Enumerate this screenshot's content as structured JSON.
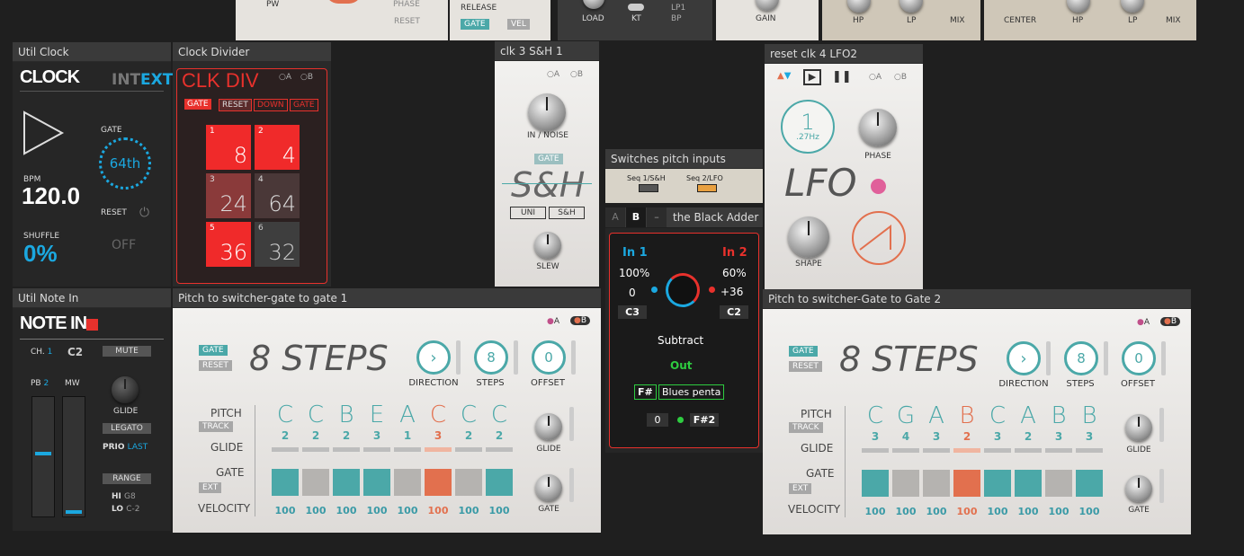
{
  "top": {
    "pw": "PW",
    "phase": "PHASE",
    "reset": "RESET",
    "release": "RELEASE",
    "gate": "GATE",
    "vel": "VEL",
    "load": "LOAD",
    "kt": "KT",
    "lp1": "LP1",
    "bp": "BP",
    "gain": "GAIN",
    "hp1": "HP",
    "lp2": "LP",
    "mix1": "MIX",
    "center": "CENTER",
    "hp2": "HP",
    "lp3": "LP",
    "mix2": "MIX"
  },
  "clock": {
    "title": "Util Clock",
    "name": "CLOCK",
    "int": "INT",
    "ext": "EXT",
    "gate": "GATE",
    "gate_val": "64th",
    "bpm_label": "BPM",
    "bpm": "120.0",
    "reset": "RESET",
    "shuffle_label": "SHUFFLE",
    "shuffle": "0%",
    "off": "OFF"
  },
  "clkdiv": {
    "title": "Clock Divider",
    "name": "CLK DIV",
    "a": "A",
    "b": "B",
    "btns": [
      "GATE",
      "RESET",
      "DOWN",
      "GATE"
    ],
    "cells": [
      {
        "n": "1",
        "v": "8"
      },
      {
        "n": "2",
        "v": "4"
      },
      {
        "n": "3",
        "v": "24"
      },
      {
        "n": "4",
        "v": "64"
      },
      {
        "n": "5",
        "v": "36"
      },
      {
        "n": "6",
        "v": "32"
      }
    ]
  },
  "sh": {
    "title": "clk 3 S&H 1",
    "a": "A",
    "b": "B",
    "in": "IN / NOISE",
    "gate": "GATE",
    "name": "S&H",
    "uni": "UNI",
    "sh": "S&H",
    "slew": "SLEW"
  },
  "sw": {
    "title": "Switches pitch inputs",
    "seq1": "Seq 1/S&H",
    "seq2": "Seq 2/LFO"
  },
  "adder": {
    "tabA": "A",
    "tabB": "B",
    "tabDash": "–",
    "title": "the Black Adder",
    "in1": "In 1",
    "in2": "In 2",
    "p1": "100%",
    "p2": "60%",
    "o1": "0",
    "o2": "+36",
    "n1": "C3",
    "n2": "C2",
    "mode": "Subtract",
    "out": "Out",
    "key": "F#",
    "scale": "Blues penta",
    "zero": "0",
    "outnote": "F#2"
  },
  "lfo": {
    "title": "reset clk 4 LFO2",
    "a": "A",
    "b": "B",
    "rate": "1",
    "hz": ".27Hz",
    "phase": "PHASE",
    "name": "LFO",
    "shape": "SHAPE"
  },
  "notein": {
    "title": "Util Note In",
    "name": "NOTE IN",
    "ch": "CH.",
    "ch_val": "1",
    "c2": "C2",
    "mute": "MUTE",
    "pb": "PB",
    "pb_val": "2",
    "mw": "MW",
    "glide": "GLIDE",
    "legato": "LEGATO",
    "prio": "PRIO",
    "prio_val": "LAST",
    "range": "RANGE",
    "hi": "HI",
    "hi_val": "G8",
    "lo": "LO",
    "lo_val": "C-2"
  },
  "seq1": {
    "title": "Pitch to switcher-gate to gate 1",
    "name": "8 STEPS",
    "gate": "GATE",
    "reset": "RESET",
    "a": "A",
    "b": "B",
    "direction": "DIRECTION",
    "steps": "STEPS",
    "steps_val": "8",
    "offset": "OFFSET",
    "offset_val": "0",
    "pitch": "PITCH",
    "track": "TRACK",
    "glide": "GLIDE",
    "gate_lbl": "GATE",
    "ext": "EXT",
    "velocity": "VELOCITY",
    "glide_k": "GLIDE",
    "gate_k": "GATE",
    "notes": [
      "C",
      "C",
      "B",
      "E",
      "A",
      "C",
      "C",
      "C"
    ],
    "octs": [
      "2",
      "2",
      "2",
      "3",
      "1",
      "3",
      "2",
      "2"
    ],
    "vels": [
      "100",
      "100",
      "100",
      "100",
      "100",
      "100",
      "100",
      "100"
    ],
    "gates": [
      "on",
      "off",
      "on",
      "on",
      "off",
      "cur",
      "off",
      "on"
    ]
  },
  "seq2": {
    "title": "Pitch to switcher-Gate to Gate 2",
    "name": "8 STEPS",
    "gate": "GATE",
    "reset": "RESET",
    "a": "A",
    "b": "B",
    "direction": "DIRECTION",
    "steps": "STEPS",
    "steps_val": "8",
    "offset": "OFFSET",
    "offset_val": "0",
    "pitch": "PITCH",
    "track": "TRACK",
    "glide": "GLIDE",
    "gate_lbl": "GATE",
    "ext": "EXT",
    "velocity": "VELOCITY",
    "glide_k": "GLIDE",
    "gate_k": "GATE",
    "notes": [
      "C",
      "G",
      "A",
      "B",
      "C",
      "A",
      "B",
      "B"
    ],
    "octs": [
      "3",
      "4",
      "3",
      "2",
      "3",
      "2",
      "3",
      "3"
    ],
    "vels": [
      "100",
      "100",
      "100",
      "100",
      "100",
      "100",
      "100",
      "100"
    ],
    "gates": [
      "on",
      "off",
      "off",
      "cur",
      "on",
      "on",
      "off",
      "on"
    ]
  },
  "colors": {
    "teal": "#4ba8a8",
    "orange": "#e2704e",
    "red": "#e8312c",
    "blue": "#1ba8e0",
    "green": "#2ecc40"
  }
}
